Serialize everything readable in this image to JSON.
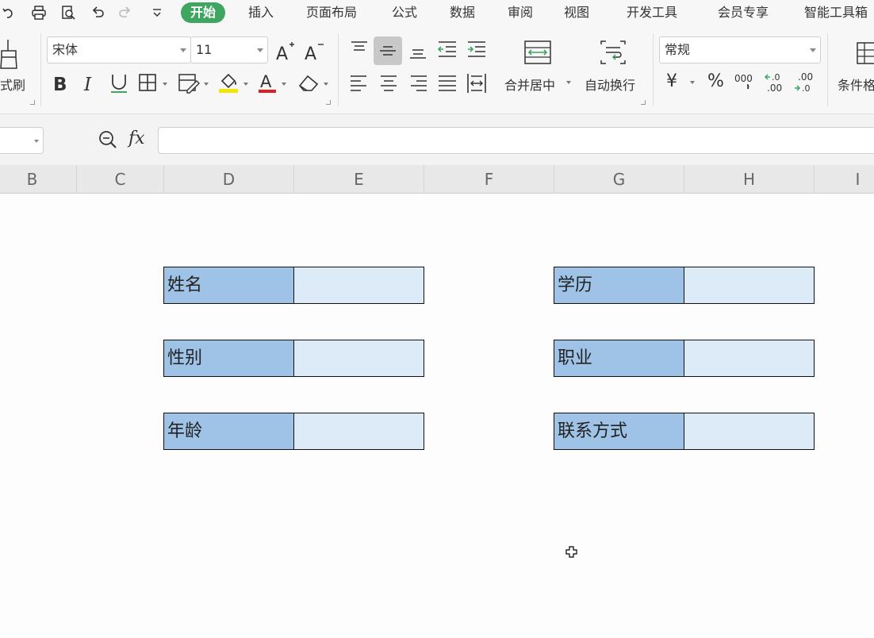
{
  "menu": {
    "tabs": [
      "开始",
      "插入",
      "页面布局",
      "公式",
      "数据",
      "审阅",
      "视图",
      "开发工具",
      "会员专享",
      "智能工具箱"
    ],
    "active_tab": "开始"
  },
  "ribbon": {
    "format_painter_label": "式刷",
    "font_name": "宋体",
    "font_size": "11",
    "merge_center_label": "合并居中",
    "wrap_text_label": "自动换行",
    "number_format": "常规",
    "conditional_format_label": "条件格",
    "currency_symbol": "¥",
    "percent_symbol": "%",
    "thousands_symbol": "000"
  },
  "formula_bar": {
    "fx_label": "fx",
    "value": ""
  },
  "columns": [
    "B",
    "C",
    "D",
    "E",
    "F",
    "G",
    "H",
    "I"
  ],
  "form": {
    "left": [
      {
        "label": "姓名",
        "value": ""
      },
      {
        "label": "性别",
        "value": ""
      },
      {
        "label": "年龄",
        "value": ""
      }
    ],
    "right": [
      {
        "label": "学历",
        "value": ""
      },
      {
        "label": "职业",
        "value": ""
      },
      {
        "label": "联系方式",
        "value": ""
      }
    ]
  },
  "colors": {
    "active_tab": "#3ea660",
    "label_fill": "#9ec3e6",
    "value_fill": "#ddeaf7",
    "highlight": "#f2e600",
    "font_color": "#e02020"
  }
}
